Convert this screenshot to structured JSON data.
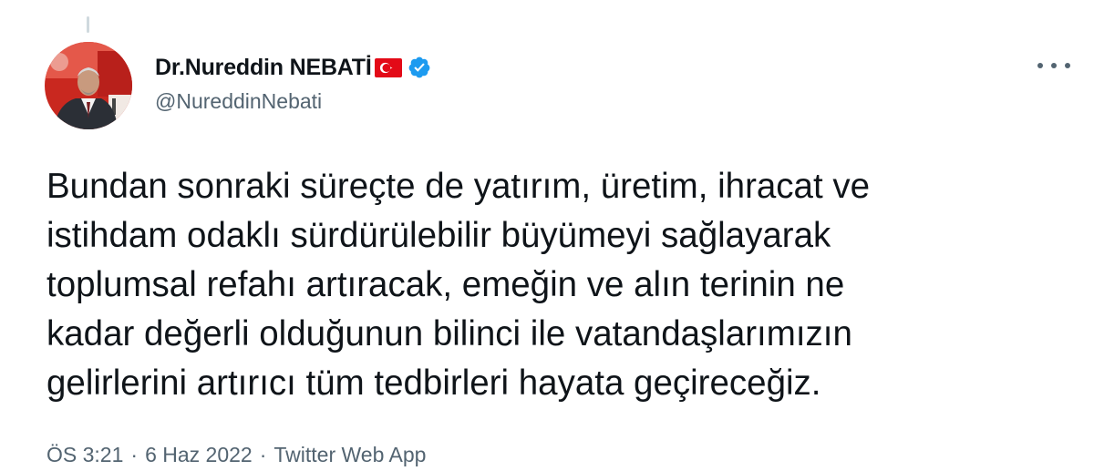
{
  "author": {
    "display_name": "Dr.Nureddin NEBATİ",
    "handle": "@NureddinNebati",
    "flag_icon": "turkey-flag",
    "verified_icon": "verified-badge",
    "verified_color": "#1d9bf0"
  },
  "tweet": {
    "lines": [
      "Bundan sonraki süreçte de yatırım, üretim, ihracat ve",
      "istihdam odaklı sürdürülebilir büyümeyi sağlayarak",
      "toplumsal refahı artıracak, emeğin ve alın terinin ne",
      "kadar değerli olduğunun bilinci ile vatandaşlarımızın",
      "gelirlerini artırıcı tüm tedbirleri hayata geçireceğiz."
    ]
  },
  "meta": {
    "time": "ÖS 3:21",
    "separator": "·",
    "date": "6 Haz 2022",
    "source": "Twitter Web App"
  },
  "icons": {
    "more": "more-options-icon"
  },
  "colors": {
    "text": "#0f1419",
    "secondary_text": "#536471",
    "verified": "#1d9bf0",
    "flag_red": "#e30a17"
  }
}
